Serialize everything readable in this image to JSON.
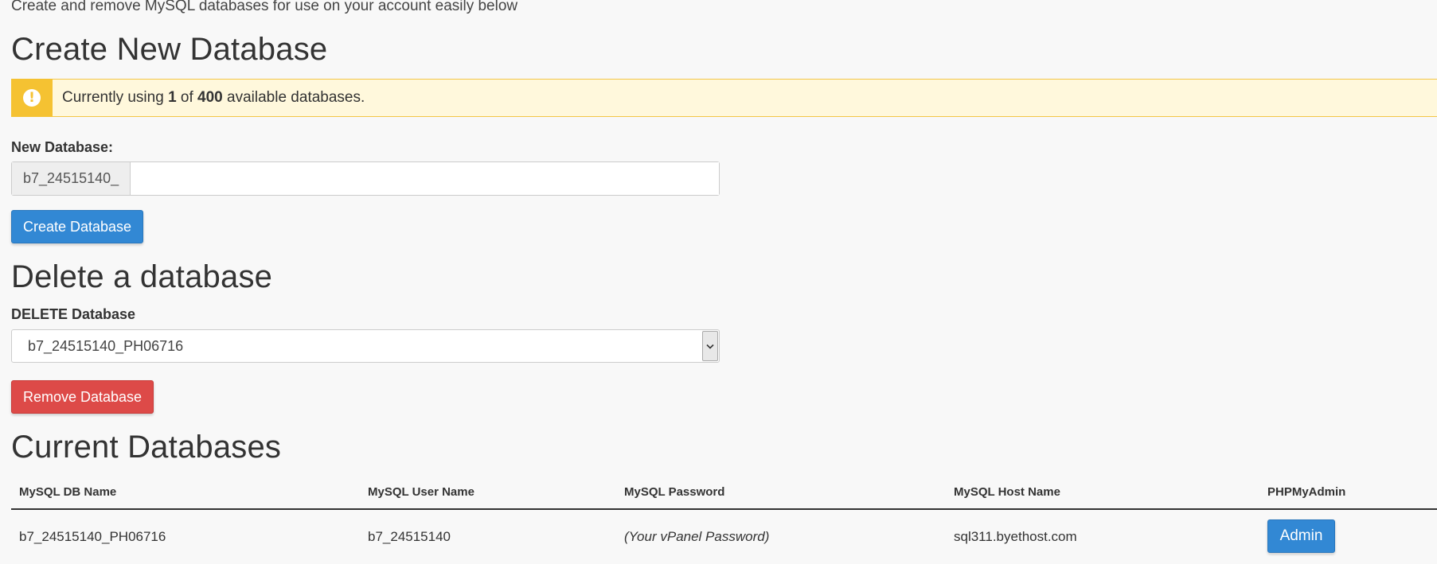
{
  "intro": "Create and remove MySQL databases for use on your account easily below",
  "create_section": {
    "title": "Create New Database",
    "alert": {
      "icon": "exclamation-circle-icon",
      "prefix": "Currently using ",
      "used": "1",
      "middle": " of ",
      "total": "400",
      "suffix": " available databases."
    },
    "field_label": "New Database:",
    "prefix": "b7_24515140_",
    "input_value": "",
    "button_label": "Create Database"
  },
  "delete_section": {
    "title": "Delete a database",
    "field_label": "DELETE Database",
    "selected": "b7_24515140_PH06716",
    "button_label": "Remove Database"
  },
  "current_section": {
    "title": "Current Databases",
    "columns": [
      "MySQL DB Name",
      "MySQL User Name",
      "MySQL Password",
      "MySQL Host Name",
      "PHPMyAdmin"
    ],
    "rows": [
      {
        "db_name": "b7_24515140_PH06716",
        "user_name": "b7_24515140",
        "password": "(Your vPanel Password)",
        "host_name": "sql311.byethost.com",
        "admin_label": "Admin"
      }
    ]
  },
  "colors": {
    "primary": "#3288d4",
    "danger": "#dd4a48",
    "warning": "#f5c232",
    "warning_bg": "#fff8dc"
  }
}
